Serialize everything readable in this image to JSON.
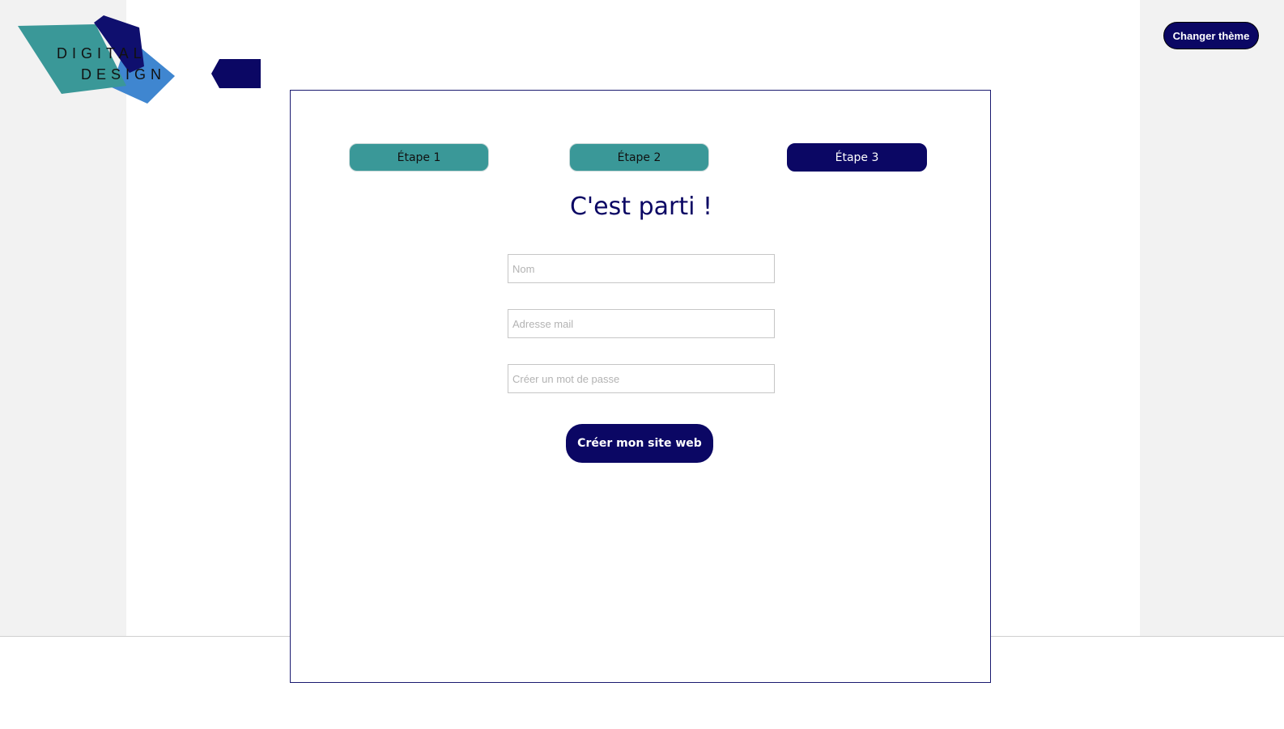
{
  "header": {
    "logo": {
      "line1": "DIGITAL",
      "line2": "DESIGN"
    },
    "theme_button_label": "Changer thème"
  },
  "form": {
    "steps": [
      {
        "label": "Étape 1"
      },
      {
        "label": "Étape 2"
      },
      {
        "label": "Étape 3"
      }
    ],
    "title": "C'est parti !",
    "fields": {
      "name_placeholder": "Nom",
      "email_placeholder": "Adresse mail",
      "password_placeholder": "Créer un mot de passe"
    },
    "submit_label": "Créer mon site web"
  },
  "colors": {
    "primary": "#0b0764",
    "teal": "#3a9898",
    "logo_blue": "#3f86d0",
    "logo_navy": "#0f0f6e"
  },
  "icons": {
    "back": "back-tab-icon"
  }
}
